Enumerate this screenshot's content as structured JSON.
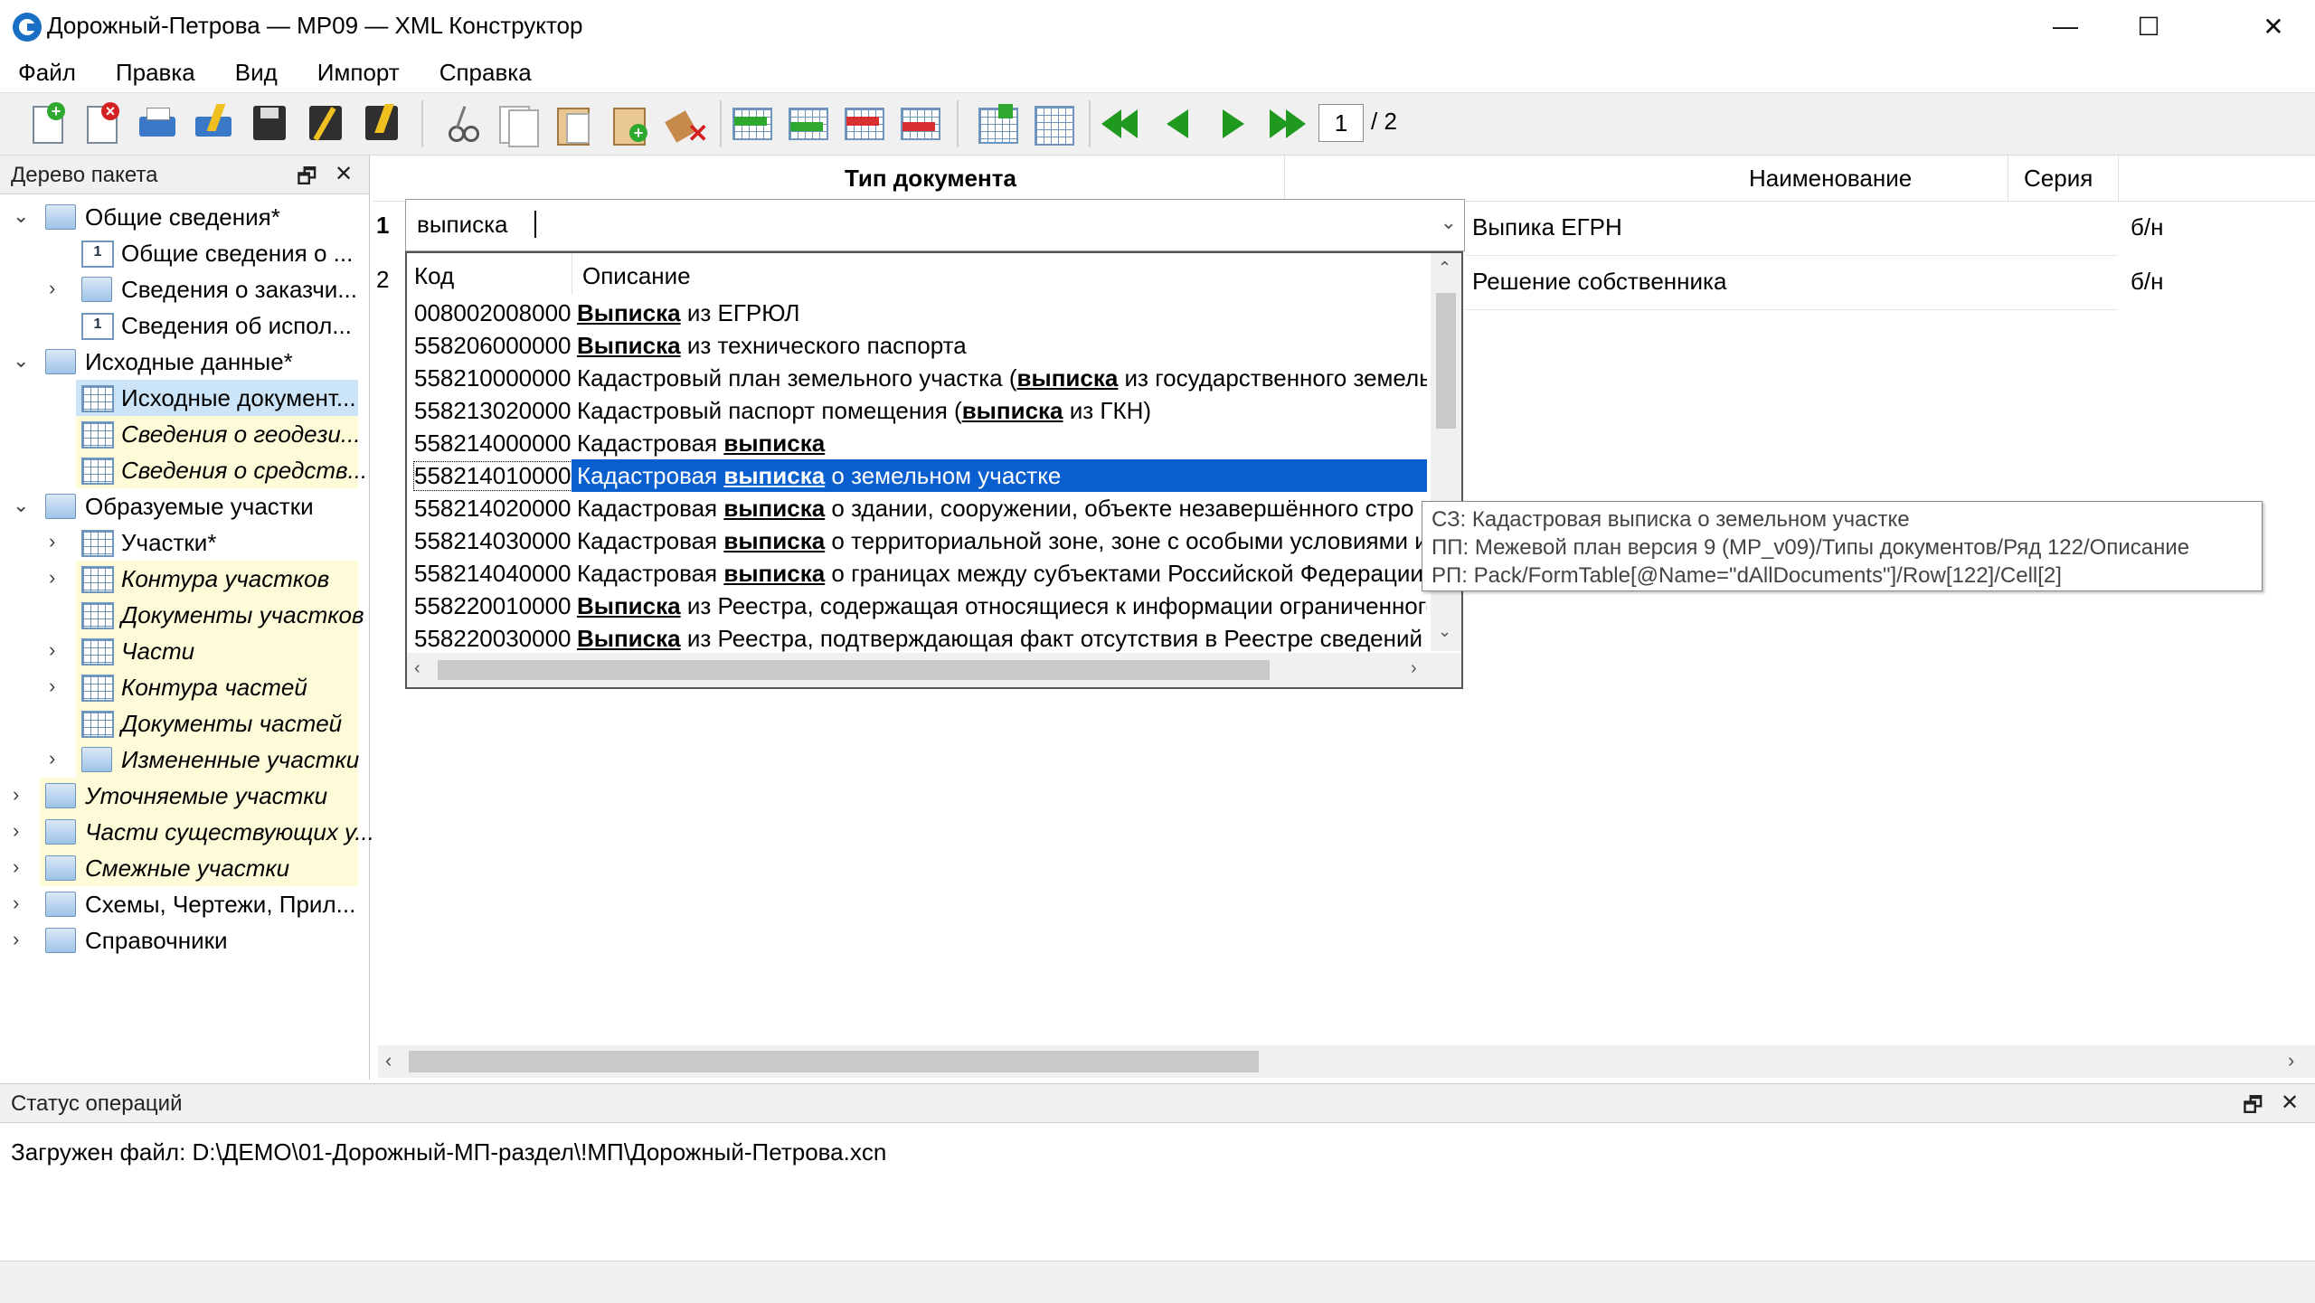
{
  "window": {
    "title": "Дорожный-Петрова — MP09 — XML Конструктор",
    "minimize": "—",
    "maximize": "☐",
    "close": "✕"
  },
  "menu": [
    "Файл",
    "Правка",
    "Вид",
    "Импорт",
    "Справка"
  ],
  "toolbar": {
    "page_current": "1",
    "page_total": "/ 2"
  },
  "left_panel": {
    "title": "Дерево пакета",
    "pin": "🗗",
    "close": "✕",
    "items": [
      {
        "label": "Общие сведения*",
        "level": 0,
        "expanded": true,
        "icon": "folder-icon"
      },
      {
        "label": "Общие сведения о ...",
        "level": 1,
        "icon": "record-icon"
      },
      {
        "label": "Сведения о заказчи...",
        "level": 1,
        "collapsed": true,
        "icon": "folder-icon"
      },
      {
        "label": "Сведения об испол...",
        "level": 1,
        "icon": "record-icon"
      },
      {
        "label": "Исходные данные*",
        "level": 0,
        "expanded": true,
        "icon": "folder-icon"
      },
      {
        "label": "Исходные документ...",
        "level": 1,
        "icon": "table-icon",
        "selected": true
      },
      {
        "label": "Сведения о геодези...",
        "level": 1,
        "icon": "table-icon",
        "italic": true
      },
      {
        "label": "Сведения о средств...",
        "level": 1,
        "icon": "table-icon",
        "italic": true
      },
      {
        "label": "Образуемые участки",
        "level": 0,
        "expanded": true,
        "icon": "folder-icon"
      },
      {
        "label": "Участки*",
        "level": 1,
        "collapsed": true,
        "icon": "table-icon"
      },
      {
        "label": "Контура участков",
        "level": 1,
        "collapsed": true,
        "icon": "table-icon",
        "italic": true
      },
      {
        "label": "Документы участков",
        "level": 1,
        "icon": "table-icon",
        "italic": true
      },
      {
        "label": "Части",
        "level": 1,
        "collapsed": true,
        "icon": "table-icon",
        "italic": true
      },
      {
        "label": "Контура частей",
        "level": 1,
        "collapsed": true,
        "icon": "table-icon",
        "italic": true
      },
      {
        "label": "Документы частей",
        "level": 1,
        "icon": "table-icon",
        "italic": true
      },
      {
        "label": "Измененные участки",
        "level": 1,
        "collapsed": true,
        "icon": "folder-icon",
        "italic": true
      },
      {
        "label": "Уточняемые участки",
        "level": 0,
        "collapsed": true,
        "icon": "folder-icon",
        "italic": true
      },
      {
        "label": "Части существующих у...",
        "level": 0,
        "collapsed": true,
        "icon": "folder-icon",
        "italic": true
      },
      {
        "label": "Смежные участки",
        "level": 0,
        "collapsed": true,
        "icon": "folder-icon",
        "italic": true
      },
      {
        "label": "Схемы, Чертежи, Прил...",
        "level": 0,
        "collapsed": true,
        "icon": "folder-icon"
      },
      {
        "label": "Справочники",
        "level": 0,
        "collapsed": true,
        "icon": "folder-icon"
      }
    ]
  },
  "grid": {
    "columns": [
      "Тип документа",
      "Наименование",
      "Серия"
    ],
    "rows": [
      {
        "num": "1",
        "type": "выписка",
        "name": "Выпика ЕГРН",
        "series": "б/н"
      },
      {
        "num": "2",
        "type": "",
        "name": "Решение собственника",
        "series": "б/н"
      }
    ]
  },
  "dropdown": {
    "col_code": "Код",
    "col_desc": "Описание",
    "rows": [
      {
        "code": "008002008000",
        "pre": "",
        "match": "Выписка",
        "post": " из ЕГРЮЛ"
      },
      {
        "code": "558206000000",
        "pre": "",
        "match": "Выписка",
        "post": " из технического паспорта"
      },
      {
        "code": "558210000000",
        "pre": "Кадастровый план земельного участка (",
        "match": "выписка",
        "post": " из государственного земель"
      },
      {
        "code": "558213020000",
        "pre": "Кадастровый паспорт помещения (",
        "match": "выписка",
        "post": " из ГКН)"
      },
      {
        "code": "558214000000",
        "pre": "Кадастровая ",
        "match": "выписка",
        "post": ""
      },
      {
        "code": "558214010000",
        "pre": "Кадастровая ",
        "match": "выписка",
        "post": " о земельном участке",
        "selected": true
      },
      {
        "code": "558214020000",
        "pre": "Кадастровая ",
        "match": "выписка",
        "post": " о здании, сооружении, объекте незавершённого стро"
      },
      {
        "code": "558214030000",
        "pre": "Кадастровая ",
        "match": "выписка",
        "post": " о территориальной зоне, зоне с особыми условиями и"
      },
      {
        "code": "558214040000",
        "pre": "Кадастровая ",
        "match": "выписка",
        "post": " о границах между субъектами Российской Федерации"
      },
      {
        "code": "558220010000",
        "pre": "",
        "match": "Выписка",
        "post": " из Реестра, содержащая относящиеся к информации ограниченного"
      },
      {
        "code": "558220030000",
        "pre": "",
        "match": "Выписка",
        "post": " из Реестра, подтверждающая факт отсутствия в Реестре сведений о"
      }
    ]
  },
  "tooltip": {
    "lines": [
      "СЗ: Кадастровая выписка о земельном участке",
      "ПП: Межевой план версия 9 (MP_v09)/Типы документов/Ряд 122/Описание",
      "РП: Pack/FormTable[@Name=\"dAllDocuments\"]/Row[122]/Cell[2]"
    ]
  },
  "status_panel": {
    "title": "Статус операций",
    "pin": "🗗",
    "close": "✕",
    "message": "Загружен файл: D:\\ДЕМО\\01-Дорожный-МП-раздел\\!МП\\Дорожный-Петрова.xcn"
  },
  "colors": {
    "selection": "#0a5fd0",
    "tree_selected": "#cce4f7",
    "tree_highlight": "#fdfbd8"
  }
}
